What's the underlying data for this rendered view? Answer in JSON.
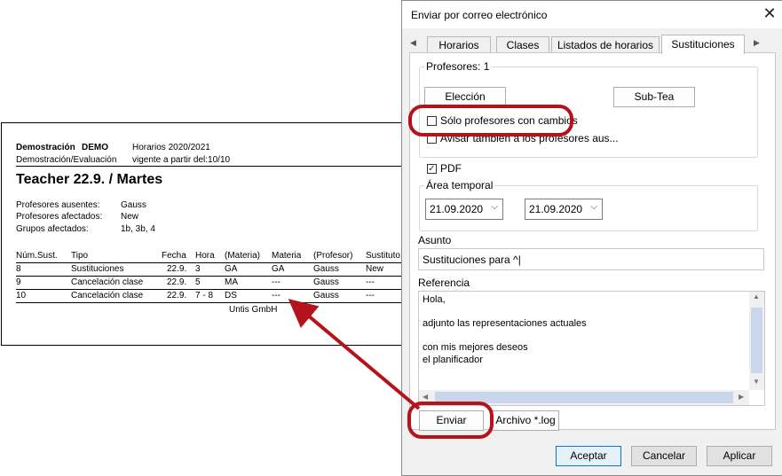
{
  "report": {
    "school": "Demostración",
    "school_code": "DEMO",
    "schedule": "Horarios 2020/2021",
    "subtitle": "Demostración/Evaluación",
    "valid_from": "vigente a partir del:10/10",
    "heading": "Teacher  22.9. / Martes",
    "summary": [
      {
        "label": "Profesores ausentes:",
        "value": "Gauss"
      },
      {
        "label": "Profesores afectados:",
        "value": "New"
      },
      {
        "label": "Grupos afectados:",
        "value": "1b, 3b, 4"
      }
    ],
    "columns": [
      "Núm.Sust.",
      "Tipo",
      "Fecha",
      "Hora",
      "(Materia)",
      "Materia",
      "(Profesor)",
      "Sustituto"
    ],
    "rows": [
      [
        "8",
        "Sustituciones",
        "22.9.",
        "3",
        "GA",
        "GA",
        "Gauss",
        "New"
      ],
      [
        "9",
        "Cancelación clase",
        "22.9.",
        "5",
        "MA",
        "---",
        "Gauss",
        "---"
      ],
      [
        "10",
        "Cancelación clase",
        "22.9.",
        "7 - 8",
        "DS",
        "---",
        "Gauss",
        "---"
      ]
    ],
    "footer": "Untis GmbH"
  },
  "dialog": {
    "title": "Enviar por correo electrónico",
    "tabs": [
      "Horarios",
      "Clases",
      "Listados de horarios",
      "Sustituciones"
    ],
    "active_tab": "Sustituciones",
    "teachers_group": "Profesores: 1",
    "eleccion_button": "Elección",
    "subtea_button": "Sub-Tea",
    "only_changed_label": "Sólo profesores con cambios",
    "only_changed_checked": false,
    "notify_absent_label": "Avisar también a los profesores aus...",
    "notify_absent_checked": false,
    "pdf_label": "PDF",
    "pdf_checked": true,
    "time_range_group": "Área temporal",
    "date_from": "21.09.2020",
    "date_to": "21.09.2020",
    "subject_label": "Asunto",
    "subject_value": "Sustituciones para ^|",
    "reference_label": "Referencia",
    "reference_lines": [
      "Hola,",
      "",
      "adjunto las representaciones actuales",
      "",
      "con mis mejores deseos",
      "el planificador"
    ],
    "send_button": "Enviar",
    "log_button": "Archivo *.log",
    "ok_button": "Aceptar",
    "cancel_button": "Cancelar",
    "apply_button": "Aplicar"
  },
  "colors": {
    "highlight": "#b5121b",
    "default_button_border": "#0078d7",
    "scroll_thumb": "#c9d6ec"
  }
}
